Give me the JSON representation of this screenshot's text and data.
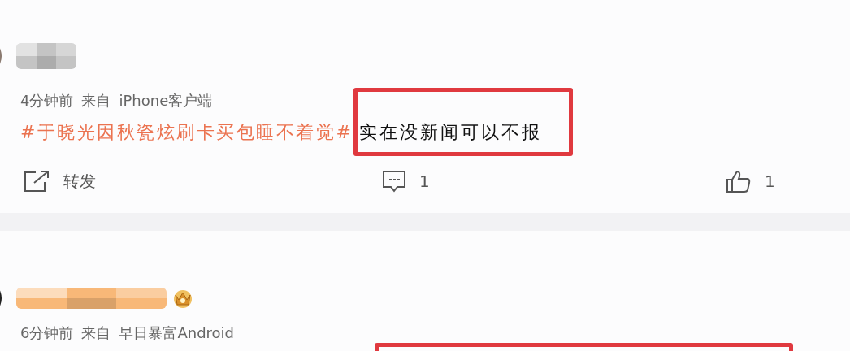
{
  "posts": [
    {
      "color": "#c4c4c4",
      "kind": "regular",
      "time": "4分钟前",
      "source_prefix": "来自",
      "source": "iPhone客户端",
      "hashtag": "#于晓光因秋瓷炫刷卡买包睡不着觉#",
      "body": "实在没新闻可以不报",
      "highlighted": true,
      "actions": {
        "repost": "转发",
        "comments": "1",
        "likes": "1"
      }
    },
    {
      "color": "#f8b878",
      "kind": "member",
      "time": "6分钟前",
      "source_prefix": "来自",
      "source": "早日暴富Android",
      "highlighted": true
    }
  ]
}
